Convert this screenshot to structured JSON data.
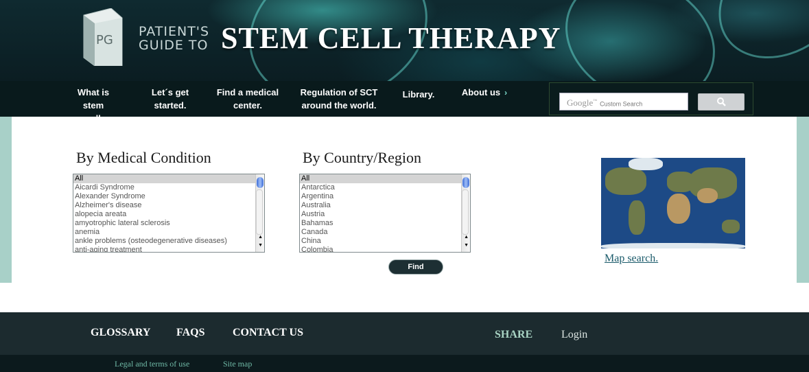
{
  "header": {
    "logo_initials": "PG",
    "logo_line1": "PATIENT'S",
    "logo_line2": "GUIDE TO",
    "title": "STEM CELL THERAPY"
  },
  "nav": {
    "items": [
      {
        "line1": "What is stem",
        "line2": "cell therapy?"
      },
      {
        "line1": "Let´s get",
        "line2": "started."
      },
      {
        "line1": "Find a medical",
        "line2": "center."
      },
      {
        "line1": "Regulation of SCT",
        "line2": "around the world."
      },
      {
        "line1": "Library.",
        "line2": ""
      },
      {
        "line1": "About us",
        "line2": ""
      }
    ],
    "about_arrow": "›"
  },
  "search": {
    "brand": "Google",
    "brand_mark": "™",
    "placeholder": "Custom Search",
    "button_icon": "search-icon"
  },
  "main": {
    "condition_heading": "By Medical Condition",
    "conditions": [
      "All",
      "Aicardi Syndrome",
      "Alexander Syndrome",
      "Alzheimer's disease",
      "alopecia areata",
      "amyotrophic lateral sclerosis",
      "anemia",
      "ankle problems (osteodegenerative diseases)",
      "anti-aging treatment"
    ],
    "country_heading": "By Country/Region",
    "countries": [
      "All",
      "Antarctica",
      "Argentina",
      "Australia",
      "Austria",
      "Bahamas",
      "Canada",
      "China",
      "Colombia"
    ],
    "selected_condition": "All",
    "selected_country": "All",
    "find_label": "Find",
    "map_link": "Map search."
  },
  "footer": {
    "links": [
      "GLOSSARY",
      "FAQS",
      "CONTACT US"
    ],
    "share": "SHARE",
    "login": "Login",
    "legal": "Legal and terms of use",
    "sitemap": "Site map"
  },
  "colors": {
    "header_bg": "#0b1d22",
    "nav_bg": "#091a1c",
    "teal_band": "#a8d0c8",
    "footer_bg": "#1c2b2f",
    "share_color": "#a9d4c4",
    "login_color": "#dde6e3",
    "sublink_color": "#6fb9a6"
  }
}
